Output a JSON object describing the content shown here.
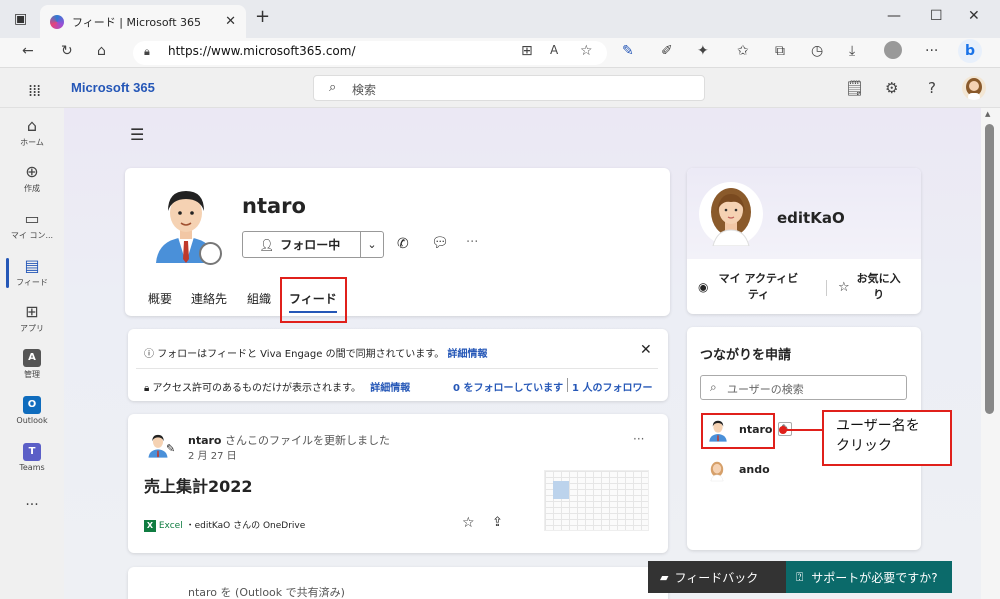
{
  "browser": {
    "tab_title": "フィード | Microsoft 365",
    "url": "https://www.microsoft365.com/"
  },
  "header": {
    "brand": "Microsoft 365",
    "search_placeholder": "検索"
  },
  "rail": [
    {
      "label": "ホーム",
      "icon": "home-icon"
    },
    {
      "label": "作成",
      "icon": "create-icon"
    },
    {
      "label": "マイ コン...",
      "icon": "folder-icon"
    },
    {
      "label": "フィード",
      "icon": "feed-icon"
    },
    {
      "label": "アプリ",
      "icon": "apps-icon"
    },
    {
      "label": "管理",
      "icon": "admin-icon"
    },
    {
      "label": "Outlook",
      "icon": "outlook-icon"
    },
    {
      "label": "Teams",
      "icon": "teams-icon"
    }
  ],
  "profile": {
    "name": "ntaro",
    "follow_label": "フォロー中",
    "tabs": [
      "概要",
      "連絡先",
      "組織",
      "フィード"
    ],
    "active_tab": "フィード"
  },
  "notice": {
    "line1": "フォローはフィードと Viva Engage の間で同期されています。",
    "line1_link": "詳細情報",
    "line2": "アクセス許可のあるものだけが表示されます。",
    "line2_link": "詳細情報",
    "following": "0 をフォローしています",
    "followers": "1 人のフォロワー"
  },
  "feed_item": {
    "author": "ntaro",
    "action": "さんこのファイルを更新しました",
    "date": "2 月 27 日",
    "title": "売上集計2022",
    "app": "Excel",
    "location": "・editKaO さんの OneDrive"
  },
  "feed_item2_partial": "ntaro を (Outlook で共有済み)",
  "me_card": {
    "name": "editKaO",
    "activity_label": "マイ アクティビティ",
    "favorites_label": "お気に入り"
  },
  "connect": {
    "title": "つながりを申請",
    "search_placeholder": "ユーザーの検索",
    "users": [
      "ntaro",
      "ando"
    ]
  },
  "callout": {
    "line1": "ユーザー名を",
    "line2": "クリック"
  },
  "bottom": {
    "feedback": "フィードバック",
    "support": "サポートが必要ですか?"
  },
  "colors": {
    "brand_blue": "#2557b7",
    "highlight_red": "#e0201b",
    "support_teal": "#0b6a6a"
  }
}
